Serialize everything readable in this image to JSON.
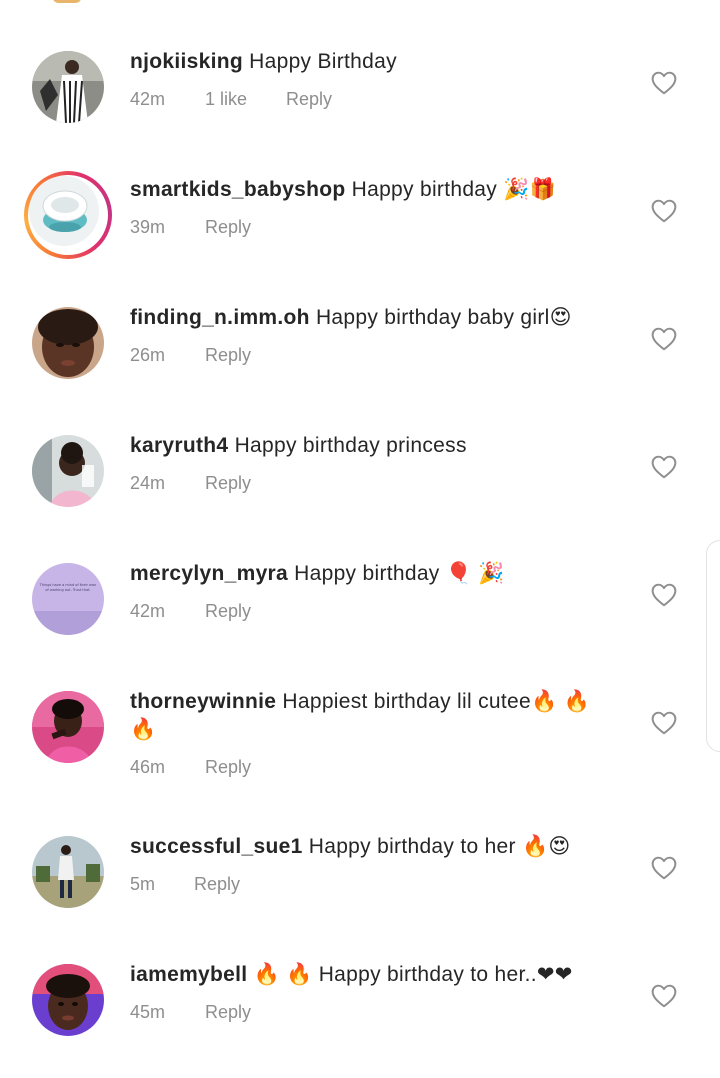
{
  "comments": [
    {
      "username": "njokiisking",
      "text": "Happy Birthday",
      "time": "42m",
      "likes": "1 like",
      "reply": "Reply"
    },
    {
      "username": "smartkids_babyshop",
      "text": "Happy birthday 🎉🎁",
      "time": "39m",
      "reply": "Reply"
    },
    {
      "username": "finding_n.imm.oh",
      "text": "Happy birthday baby girl😍",
      "time": "26m",
      "reply": "Reply"
    },
    {
      "username": "karyruth4",
      "text": "Happy birthday princess",
      "time": "24m",
      "reply": "Reply"
    },
    {
      "username": "mercylyn_myra",
      "text": "Happy birthday 🎈 🎉",
      "time": "42m",
      "reply": "Reply"
    },
    {
      "username": "thorneywinnie",
      "text": "Happiest birthday lil cutee🔥 🔥 🔥",
      "time": "46m",
      "reply": "Reply"
    },
    {
      "username": "successful_sue1",
      "text": "Happy birthday to her 🔥😍",
      "time": "5m",
      "reply": "Reply"
    },
    {
      "username": "iamemybell",
      "text": "🔥 🔥 Happy birthday to her..❤❤",
      "time": "45m",
      "reply": "Reply"
    }
  ],
  "avatar_text": {
    "mercylyn_myra": "Things have a mind of their own of working out. Trust that."
  },
  "colors": {
    "meta_gray": "#8e8e8e",
    "text": "#262626",
    "story_ring_start": "#f77737",
    "story_ring_end": "#c13584"
  },
  "icons": {
    "like": "heart-outline-icon"
  }
}
